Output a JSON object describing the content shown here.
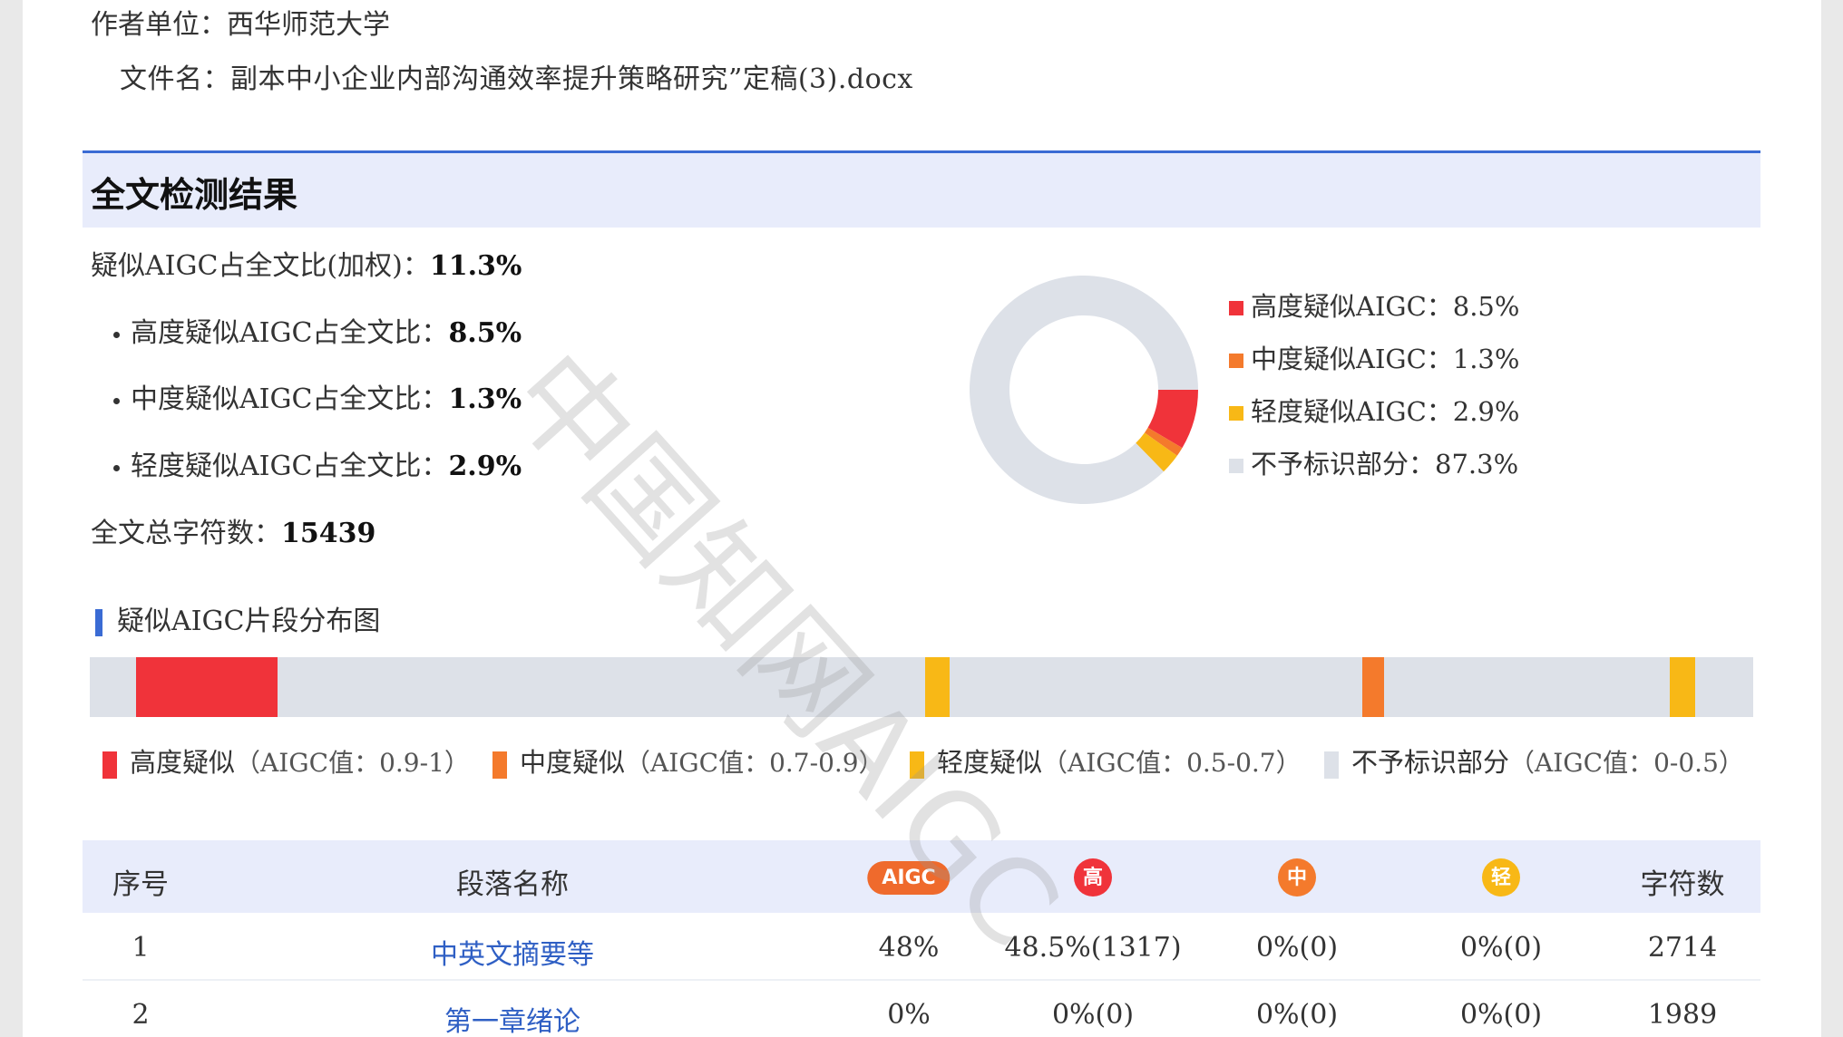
{
  "meta": {
    "author_label": "作者单位：",
    "author_value": "西华师范大学",
    "file_label": "文件名：",
    "file_value": "副本中小企业内部沟通效率提升策略研究”定稿(3).docx"
  },
  "section": {
    "title": "全文检测结果"
  },
  "stats": {
    "overall_label": "疑似AIGC占全文比(加权)：",
    "overall_value": "11.3%",
    "high_label": "高度疑似AIGC占全文比：",
    "high_value": "8.5%",
    "mid_label": "中度疑似AIGC占全文比：",
    "mid_value": "1.3%",
    "low_label": "轻度疑似AIGC占全文比：",
    "low_value": "2.9%",
    "chars_label": "全文总字符数：",
    "chars_value": "15439"
  },
  "colors": {
    "high": "#f0333a",
    "mid": "#f47a2c",
    "low": "#f8b816",
    "none": "#dde1e8",
    "accent": "#3a6bd4"
  },
  "chart_data": {
    "type": "pie",
    "labels": [
      "高度疑似AIGC",
      "中度疑似AIGC",
      "轻度疑似AIGC",
      "不予标识部分"
    ],
    "values": [
      8.5,
      1.3,
      2.9,
      87.3
    ],
    "legend": [
      "高度疑似AIGC：8.5%",
      "中度疑似AIGC：1.3%",
      "轻度疑似AIGC：2.9%",
      "不予标识部分：87.3%"
    ],
    "legend_position": "right"
  },
  "distribution": {
    "title": "疑似AIGC片段分布图",
    "segments": [
      {
        "level": "high",
        "start": 0.028,
        "end": 0.113
      },
      {
        "level": "low",
        "start": 0.502,
        "end": 0.517
      },
      {
        "level": "mid",
        "start": 0.765,
        "end": 0.778
      },
      {
        "level": "low",
        "start": 0.95,
        "end": 0.965
      }
    ],
    "legend": [
      {
        "level": "high",
        "name": "高度疑似",
        "range": "（AIGC值：0.9-1）"
      },
      {
        "level": "mid",
        "name": "中度疑似",
        "range": "（AIGC值：0.7-0.9）"
      },
      {
        "level": "low",
        "name": "轻度疑似",
        "range": "（AIGC值：0.5-0.7）"
      },
      {
        "level": "none",
        "name": "不予标识部分",
        "range": "（AIGC值：0-0.5）"
      }
    ]
  },
  "table": {
    "headers": {
      "index": "序号",
      "name": "段落名称",
      "aigc": "AIGC",
      "high": "高",
      "mid": "中",
      "low": "轻",
      "chars": "字符数"
    },
    "rows": [
      {
        "index": "1",
        "name": "中英文摘要等",
        "aigc": "48%",
        "high": "48.5%(1317)",
        "mid": "0%(0)",
        "low": "0%(0)",
        "chars": "2714"
      },
      {
        "index": "2",
        "name": "第一章绪论",
        "aigc": "0%",
        "high": "0%(0)",
        "mid": "0%(0)",
        "low": "0%(0)",
        "chars": "1989"
      }
    ]
  },
  "watermark": "中国知网AIGC"
}
